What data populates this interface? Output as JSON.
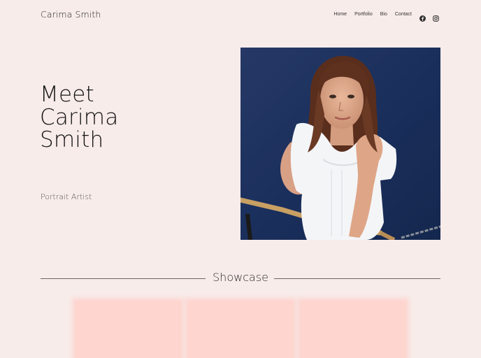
{
  "site": {
    "name": "Carima Smith"
  },
  "nav": {
    "items": [
      {
        "label": "Home"
      },
      {
        "label": "Portfolio"
      },
      {
        "label": "Bio"
      },
      {
        "label": "Contact"
      }
    ],
    "social": [
      {
        "icon": "facebook-icon"
      },
      {
        "icon": "instagram-icon"
      }
    ]
  },
  "hero": {
    "title_lines": [
      "Meet",
      "Carima",
      "Smith"
    ],
    "subtitle": "Portrait Artist"
  },
  "showcase": {
    "title": "Showcase"
  },
  "colors": {
    "background": "#f8ecea",
    "tile": "#ffd5cf",
    "portrait_bg": "#1f3460"
  }
}
